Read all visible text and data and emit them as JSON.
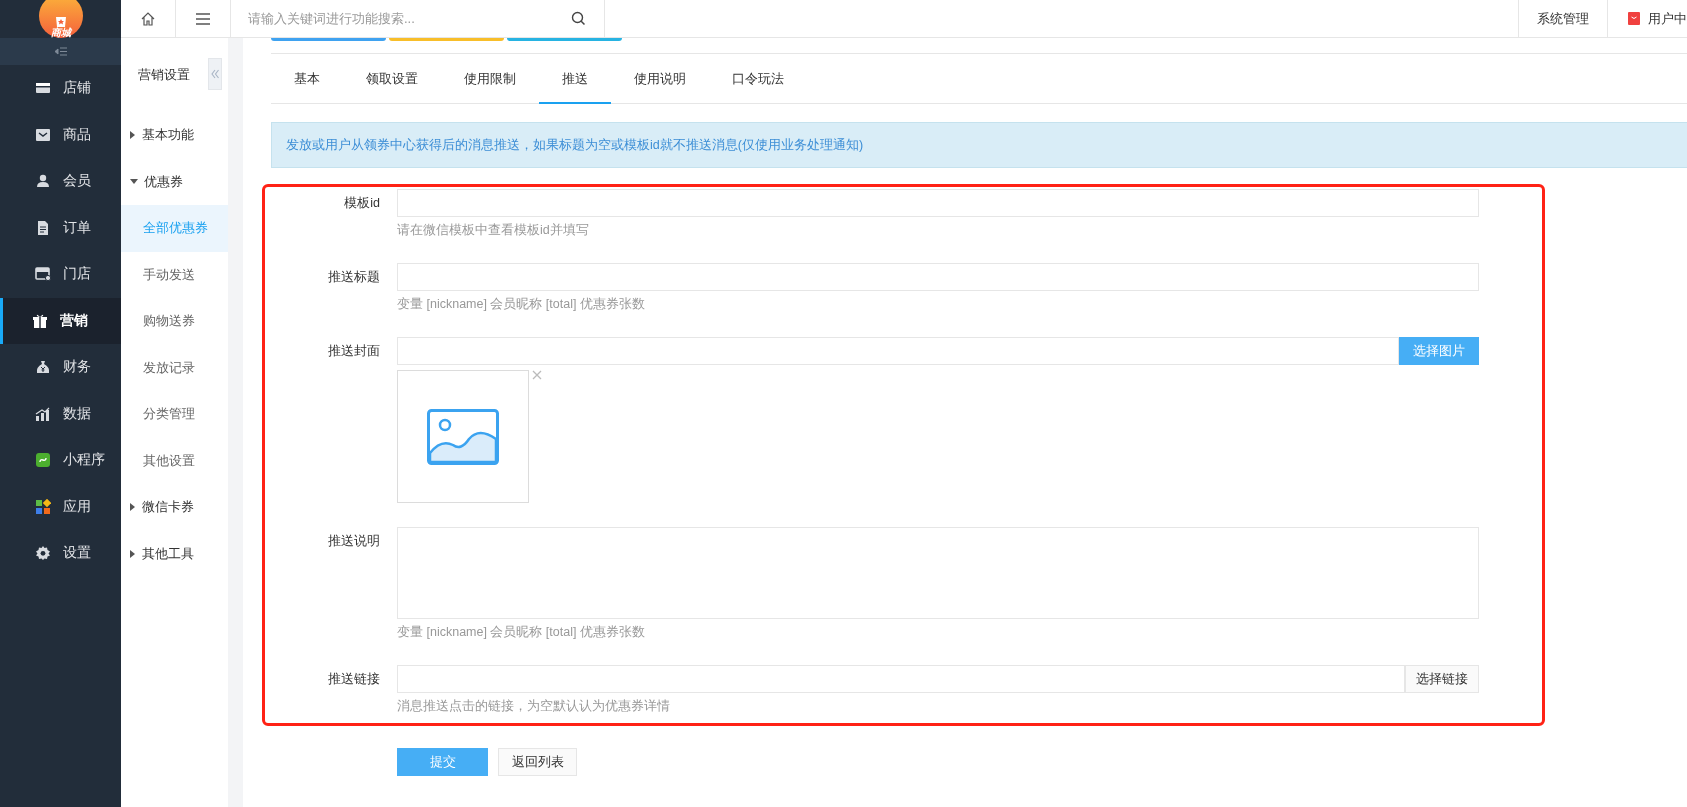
{
  "logo": {
    "text": "商城"
  },
  "main_nav": {
    "items": [
      {
        "label": "店铺",
        "selected": false
      },
      {
        "label": "商品",
        "selected": false
      },
      {
        "label": "会员",
        "selected": false
      },
      {
        "label": "订单",
        "selected": false
      },
      {
        "label": "门店",
        "selected": false
      },
      {
        "label": "营销",
        "selected": true
      },
      {
        "label": "财务",
        "selected": false
      },
      {
        "label": "数据",
        "selected": false
      },
      {
        "label": "小程序",
        "selected": false
      },
      {
        "label": "应用",
        "selected": false
      },
      {
        "label": "设置",
        "selected": false
      }
    ]
  },
  "sub_nav": {
    "title": "营销设置",
    "items": [
      {
        "label": "基本功能",
        "expanded": false
      },
      {
        "label": "优惠券",
        "expanded": true,
        "children": [
          {
            "label": "全部优惠券",
            "selected": true
          },
          {
            "label": "手动发送",
            "selected": false
          },
          {
            "label": "购物送券",
            "selected": false
          },
          {
            "label": "发放记录",
            "selected": false
          },
          {
            "label": "分类管理",
            "selected": false
          },
          {
            "label": "其他设置",
            "selected": false
          }
        ]
      },
      {
        "label": "微信卡券",
        "expanded": false
      },
      {
        "label": "其他工具",
        "expanded": false
      }
    ]
  },
  "top_bar": {
    "search": {
      "placeholder": "请输入关键词进行功能搜索..."
    },
    "links": [
      {
        "label": "系统管理",
        "kind": "plain"
      },
      {
        "label": "用户中",
        "kind": "bag"
      }
    ]
  },
  "tabs": [
    {
      "label": "基本",
      "selected": false
    },
    {
      "label": "领取设置",
      "selected": false
    },
    {
      "label": "使用限制",
      "selected": false
    },
    {
      "label": "推送",
      "selected": true
    },
    {
      "label": "使用说明",
      "selected": false
    },
    {
      "label": "口令玩法",
      "selected": false
    }
  ],
  "alert": {
    "text": "发放或用户从领券中心获得后的消息推送，如果标题为空或模板id就不推送消息(仅使用业务处理通知)"
  },
  "form": {
    "fields": [
      {
        "label": "模板id",
        "kind": "input",
        "help": "请在微信模板中查看模板id并填写"
      },
      {
        "label": "推送标题",
        "kind": "input",
        "help": "变量 [nickname] 会员昵称 [total] 优惠券张数"
      },
      {
        "label": "推送封面",
        "kind": "image",
        "button": {
          "label": "选择图片",
          "kind": "primary"
        }
      },
      {
        "label": "推送说明",
        "kind": "textarea",
        "help": "变量 [nickname] 会员昵称 [total] 优惠券张数"
      },
      {
        "label": "推送链接",
        "kind": "input",
        "button": {
          "label": "选择链接",
          "kind": "default"
        },
        "help": "消息推送点击的链接，为空默认认为优惠券详情"
      }
    ]
  },
  "actions": [
    {
      "label": "提交",
      "kind": "primary"
    },
    {
      "label": "返回列表",
      "kind": "default"
    }
  ]
}
